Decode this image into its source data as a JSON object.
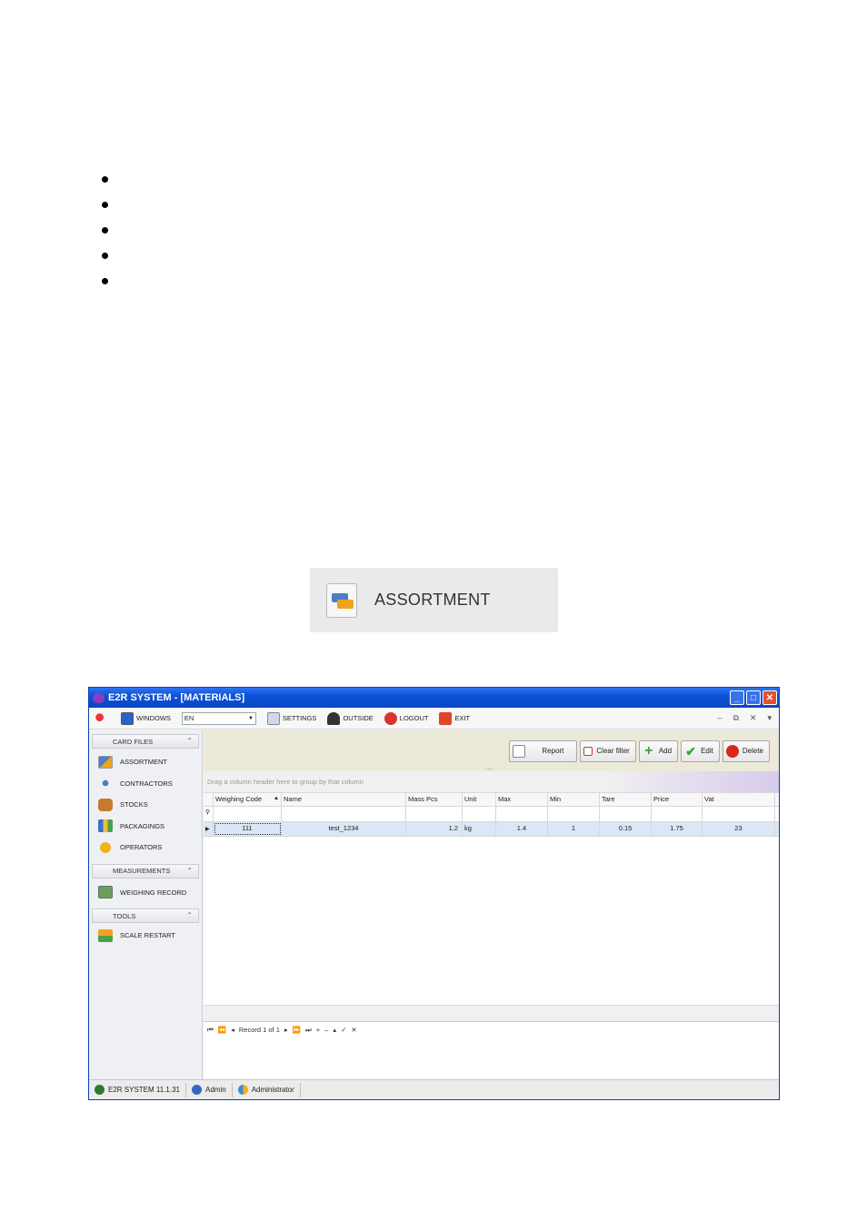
{
  "callout": {
    "label": "ASSORTMENT",
    "icon": "assortment-icon"
  },
  "window": {
    "title": "E2R SYSTEM - [MATERIALS]",
    "controls": {
      "minimize": "_",
      "maximize": "□",
      "close": "✕"
    }
  },
  "toolbar": {
    "windows_label": "WINDOWS",
    "language": "EN",
    "settings_label": "SETTINGS",
    "outside_label": "OUTSIDE",
    "logout_label": "LOGOUT",
    "exit_label": "EXIT",
    "right_controls": [
      "–",
      "⧉",
      "✕",
      "▾"
    ]
  },
  "sidebar": {
    "card_files": {
      "header": "CARD FILES",
      "items": [
        "ASSORTMENT",
        "CONTRACTORS",
        "STOCKS",
        "PACKAGINGS",
        "OPERATORS"
      ]
    },
    "measurements": {
      "header": "MEASUREMENTS",
      "items": [
        "WEIGHING RECORD"
      ]
    },
    "tools": {
      "header": "TOOLS",
      "items": [
        "SCALE RESTART"
      ]
    }
  },
  "actions": {
    "report": "Report",
    "clear_filter": "Clear filter",
    "add": "Add",
    "edit": "Edit",
    "delete": "Delete"
  },
  "grid": {
    "group_hint": "Drag a column header here to group by that column",
    "columns": [
      "Weighing Code",
      "Name",
      "Mass Pcs",
      "Unit",
      "Max",
      "Min",
      "Tare",
      "Price",
      "Vat"
    ],
    "rows": [
      {
        "code": "111",
        "name": "test_1234",
        "mass": "1.2",
        "unit": "kg",
        "max": "1.4",
        "min": "1",
        "tare": "0.15",
        "price": "1.75",
        "vat": "23"
      }
    ],
    "navigator": {
      "record_text": "Record 1 of 1"
    }
  },
  "status": {
    "version": "E2R SYSTEM 11.1.31",
    "user": "Admin",
    "role": "Administrator"
  },
  "colors": {
    "titlebar": "#0b54d8",
    "selection": "#dbe6f6",
    "action_bar": "#ece9d8"
  }
}
